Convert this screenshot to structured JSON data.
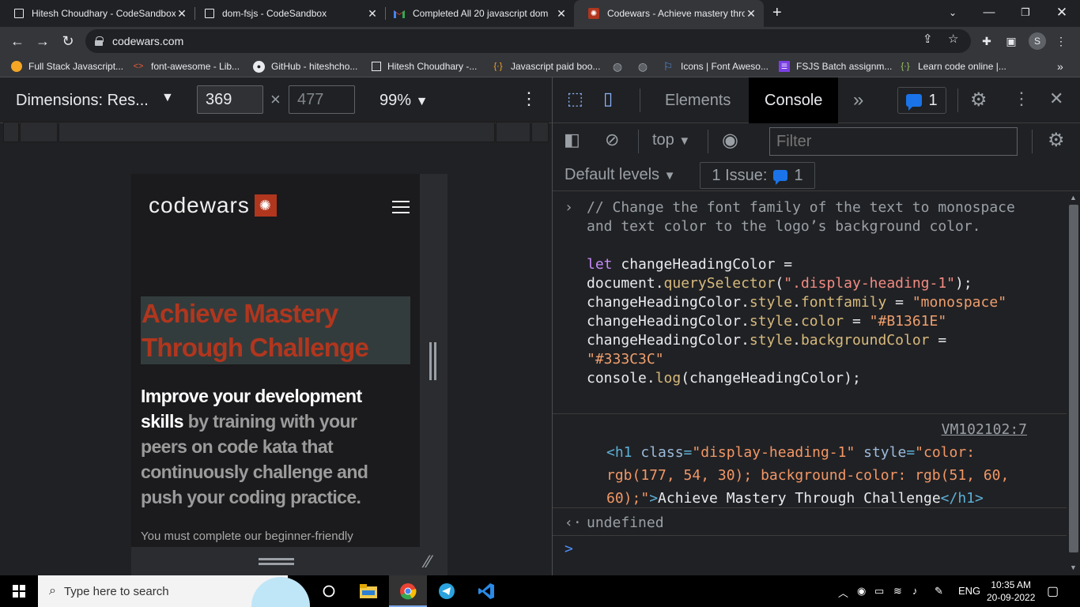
{
  "browser": {
    "tabs": [
      {
        "title": "Hitesh Choudhary - CodeSandbox",
        "close": "✕"
      },
      {
        "title": "dom-fsjs - CodeSandbox",
        "close": "✕"
      },
      {
        "title": "Completed All 20 javascript dom",
        "close": "✕"
      },
      {
        "title": "Codewars - Achieve mastery thro",
        "close": "✕"
      }
    ],
    "new_tab": "+",
    "url": "codewars.com",
    "profile_initial": "S",
    "bookmarks": [
      "Full Stack Javascript...",
      "font-awesome - Lib...",
      "GitHub - hiteshcho...",
      "Hitesh Choudhary -...",
      "Javascript paid boo...",
      "",
      "",
      "Icons | Font Aweso...",
      "FSJS Batch assignm...",
      "Learn code online |..."
    ],
    "bookmarks_more": "»"
  },
  "device_toolbar": {
    "dimensions_label": "Dimensions: Res...",
    "width": "369",
    "height": "477",
    "times": "×",
    "zoom": "99%"
  },
  "page": {
    "logo_text": "codewars",
    "hero_heading": "Achieve Mastery Through Challenge",
    "sub_bold": "Improve your development skills",
    "sub_rest": " by training with your peers on code kata that continuously challenge and push your coding practice.",
    "small_text": "You must complete our beginner-friendly",
    "colors": {
      "heading": "#B1361E",
      "heading_bg": "#333C3C"
    }
  },
  "devtools": {
    "tabs": {
      "elements": "Elements",
      "console": "Console",
      "more": "»"
    },
    "issues_count": "1",
    "context": "top",
    "filter_placeholder": "Filter",
    "default_levels": "Default levels",
    "issue_label": "1 Issue:",
    "issue_count": "1",
    "code": {
      "comment": "// Change the font family of the text to monospace and text color to the logo’s background color.",
      "l1_kw": "let",
      "l1_rest": " changeHeadingColor =",
      "l2_a": "document.",
      "l2_fn": "querySelector",
      "l2_b": "(",
      "l2_str": "\".display-heading-1\"",
      "l2_c": ");",
      "l3_a": "changeHeadingColor.",
      "l3_b": "style",
      "l3_c": ".",
      "l3_d": "fontfamily",
      "l3_e": " = ",
      "l3_str": "\"monospace\"",
      "l4_a": "changeHeadingColor.",
      "l4_b": "style",
      "l4_c": ".",
      "l4_d": "color",
      "l4_e": " = ",
      "l4_str": "\"#B1361E\"",
      "l5_a": "changeHeadingColor.",
      "l5_b": "style",
      "l5_c": ".",
      "l5_d": "backgroundColor",
      "l5_e": " =",
      "l5_str": "\"#333C3C\"",
      "l6_a": "console.",
      "l6_fn": "log",
      "l6_b": "(changeHeadingColor);"
    },
    "vm_link": "VM102102:7",
    "output": {
      "open": "<h1",
      "attr1": " class",
      "eq1": "=",
      "val1": "\"display-heading-1\"",
      "attr2": " style",
      "eq2": "=",
      "val2": "\"color: rgb(177, 54, 30); background-color: rgb(51, 60, 60);\"",
      "gt": ">",
      "text": "Achieve Mastery Through Challenge",
      "close": "</h1>"
    },
    "undefined": "undefined",
    "prompt": ">"
  },
  "taskbar": {
    "search_placeholder": "Type here to search",
    "lang": "ENG",
    "time": "10:35 AM",
    "date": "20-09-2022"
  }
}
